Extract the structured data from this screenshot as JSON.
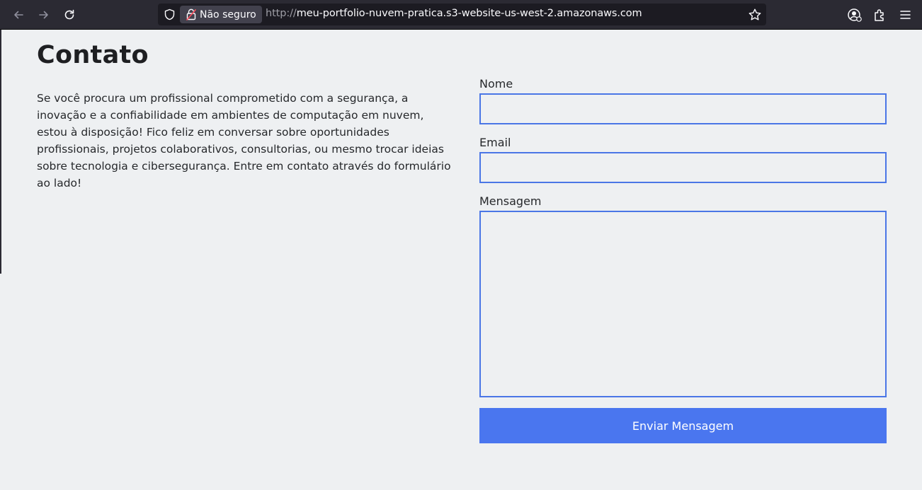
{
  "browser": {
    "security_label": "Não seguro",
    "url_protocol": "http://",
    "url_host": "meu-portfolio-nuvem-pratica.s3-website-us-west-2.amazonaws.com",
    "icons": [
      "back-arrow-icon",
      "forward-arrow-icon",
      "reload-icon",
      "shield-icon",
      "insecure-lock-icon",
      "bookmark-star-icon",
      "account-icon",
      "extensions-icon",
      "menu-icon"
    ]
  },
  "contact": {
    "title": "Contato",
    "intro": "Se você procura um profissional comprometido com a segurança, a inovação e a confiabilidade em ambientes de computação em nuvem, estou à disposição! Fico feliz em conversar sobre oportunidades profissionais, projetos colaborativos, consultorias, ou mesmo trocar ideias sobre tecnologia e cibersegurança. Entre em contato através do formulário ao lado!",
    "form": {
      "name_label": "Nome",
      "name_value": "",
      "email_label": "Email",
      "email_value": "",
      "message_label": "Mensagem",
      "message_value": "",
      "submit_label": "Enviar Mensagem"
    }
  },
  "colors": {
    "accent": "#4a76ef",
    "page_background": "#eef0f2",
    "toolbar_background": "#2b2a33"
  }
}
